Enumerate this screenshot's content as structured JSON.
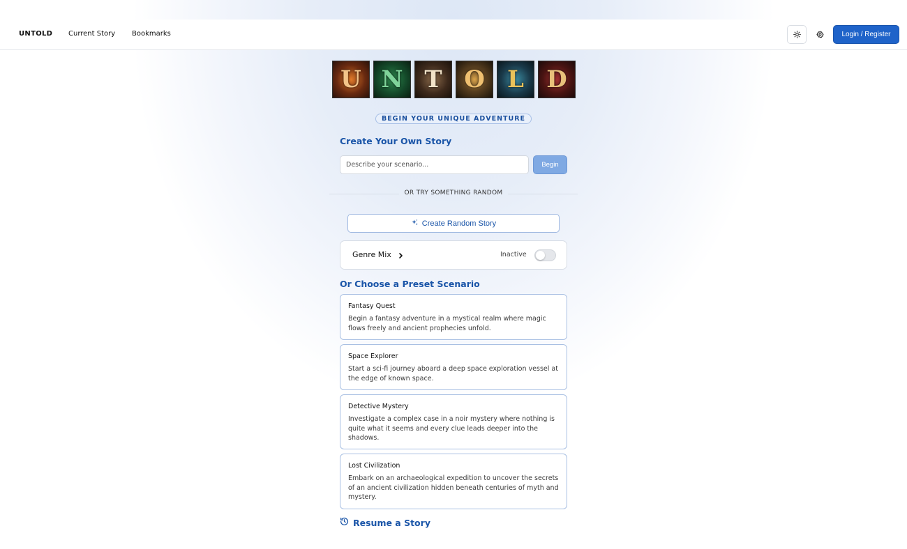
{
  "nav": {
    "brand": "UNTOLD",
    "links": [
      "Current Story",
      "Bookmarks"
    ],
    "login_label": "Login / Register",
    "theme_icon": "sun-icon",
    "settings_icon": "gear-icon"
  },
  "logo": {
    "letters": [
      "U",
      "N",
      "T",
      "O",
      "L",
      "D"
    ]
  },
  "tagline": "BEGIN YOUR UNIQUE ADVENTURE",
  "create": {
    "title": "Create Your Own Story",
    "placeholder": "Describe your scenario...",
    "begin_label": "Begin"
  },
  "divider_text": "OR TRY SOMETHING RANDOM",
  "random": {
    "label": "Create Random Story",
    "icon": "sparkles-icon"
  },
  "genre_mix": {
    "label": "Genre Mix",
    "status": "Inactive",
    "enabled": false
  },
  "presets": {
    "title": "Or Choose a Preset Scenario",
    "items": [
      {
        "name": "Fantasy Quest",
        "description": "Begin a fantasy adventure in a mystical realm where magic flows freely and ancient prophecies unfold."
      },
      {
        "name": "Space Explorer",
        "description": "Start a sci-fi journey aboard a deep space exploration vessel at the edge of known space."
      },
      {
        "name": "Detective Mystery",
        "description": "Investigate a complex case in a noir mystery where nothing is quite what it seems and every clue leads deeper into the shadows."
      },
      {
        "name": "Lost Civilization",
        "description": "Embark on an archaeological expedition to uncover the secrets of an ancient civilization hidden beneath centuries of myth and mystery."
      }
    ]
  },
  "resume_label": "Resume a Story",
  "colors": {
    "accent": "#1f63c9",
    "heading": "#1a55a8",
    "begin_disabled": "#7fa9e3"
  }
}
